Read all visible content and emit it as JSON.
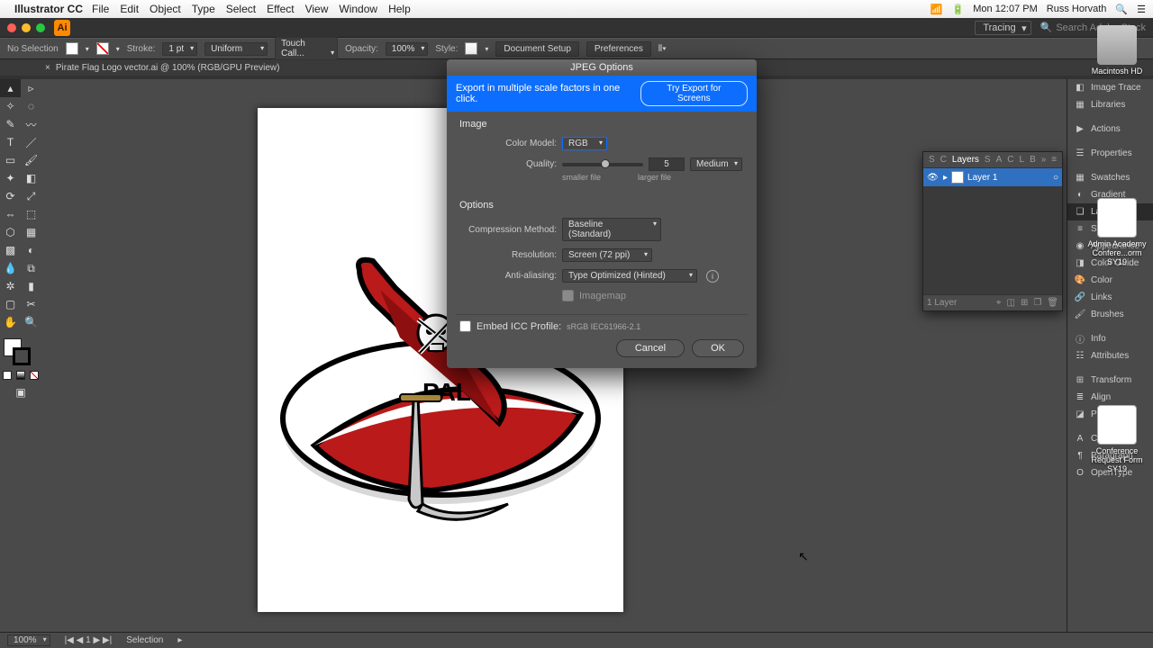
{
  "mac": {
    "app": "Illustrator CC",
    "menus": [
      "File",
      "Edit",
      "Object",
      "Type",
      "Select",
      "Effect",
      "View",
      "Window",
      "Help"
    ],
    "time": "Mon 12:07 PM",
    "user": "Russ Horvath"
  },
  "workspace": {
    "name": "Tracing",
    "search_placeholder": "Search Adobe Stock"
  },
  "control": {
    "selection": "No Selection",
    "stroke_label": "Stroke:",
    "stroke_val": "1 pt",
    "uniform": "Uniform",
    "brush": "Touch Call...",
    "opacity_label": "Opacity:",
    "opacity_val": "100%",
    "style_label": "Style:",
    "doc_setup": "Document Setup",
    "prefs": "Preferences"
  },
  "tab": {
    "title": "Pirate Flag Logo vector.ai @ 100% (RGB/GPU Preview)"
  },
  "dialog": {
    "title": "JPEG Options",
    "banner_text": "Export in multiple scale factors in one click.",
    "banner_btn": "Try Export for Screens",
    "image_hdr": "Image",
    "color_model_label": "Color Model:",
    "color_model_val": "RGB",
    "quality_label": "Quality:",
    "quality_val": "5",
    "quality_preset": "Medium",
    "smaller": "smaller file",
    "larger": "larger file",
    "options_hdr": "Options",
    "compression_label": "Compression Method:",
    "compression_val": "Baseline (Standard)",
    "resolution_label": "Resolution:",
    "resolution_val": "Screen (72 ppi)",
    "aa_label": "Anti-aliasing:",
    "aa_val": "Type Optimized (Hinted)",
    "imagemap": "Imagemap",
    "embed_label": "Embed ICC Profile:",
    "embed_profile": "sRGB IEC61966-2.1",
    "cancel": "Cancel",
    "ok": "OK"
  },
  "dock": {
    "items1": [
      "Image Trace",
      "Libraries"
    ],
    "items2": [
      "Actions"
    ],
    "items3": [
      "Properties"
    ],
    "items4": [
      "Swatches",
      "Gradient",
      "Layers",
      "Stroke",
      "Appearance",
      "Color Guide",
      "Color",
      "Links",
      "Brushes"
    ],
    "items5": [
      "Info",
      "Attributes"
    ],
    "items6": [
      "Transform",
      "Align",
      "Pathfinder"
    ],
    "items7": [
      "Character",
      "Paragraph",
      "OpenType"
    ]
  },
  "layers": {
    "tabs": [
      "S",
      "C",
      "Layers",
      "S",
      "A",
      "C",
      "L",
      "B"
    ],
    "row_name": "Layer 1",
    "footer": "1 Layer"
  },
  "desktop": {
    "hd": "Macintosh HD",
    "d1": "Admin Academy Confere...orm SY19",
    "d2": "Conference Request Form SY19"
  },
  "status": {
    "zoom": "100%",
    "page": "1",
    "mode": "Selection"
  }
}
